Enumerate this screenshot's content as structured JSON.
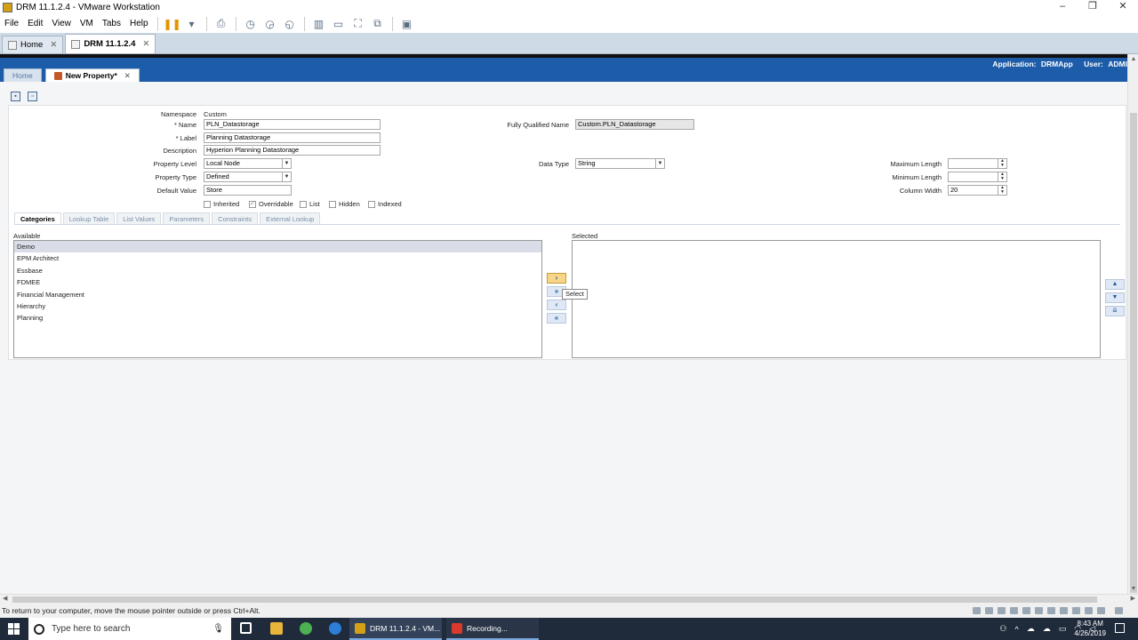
{
  "window": {
    "title": "DRM 11.1.2.4 - VMware Workstation",
    "controls": [
      "–",
      "❐",
      "✕"
    ]
  },
  "menubar": {
    "items": [
      "File",
      "Edit",
      "View",
      "VM",
      "Tabs",
      "Help"
    ]
  },
  "vm_tabs": [
    {
      "label": "Home",
      "active": false
    },
    {
      "label": "DRM 11.1.2.4",
      "active": true
    }
  ],
  "drm": {
    "banner": {
      "application_label": "Application:",
      "application_value": "DRMApp",
      "user_label": "User:",
      "user_value": "ADMI"
    },
    "tabs": [
      {
        "label": "Home",
        "active": false
      },
      {
        "label": "New Property*",
        "active": true
      }
    ],
    "form": {
      "namespace_label": "Namespace",
      "namespace_value": "Custom",
      "name_label": "* Name",
      "name_value": "PLN_Datastorage",
      "label_label": "* Label",
      "label_value": "Planning Datastorage",
      "description_label": "Description",
      "description_value": "Hyperion Planning Datastorage",
      "property_level_label": "Property Level",
      "property_level_value": "Local Node",
      "property_type_label": "Property Type",
      "property_type_value": "Defined",
      "default_value_label": "Default Value",
      "default_value_value": "Store",
      "fqn_label": "Fully Qualified Name",
      "fqn_value": "Custom.PLN_Datastorage",
      "data_type_label": "Data Type",
      "data_type_value": "String",
      "max_length_label": "Maximum Length",
      "max_length_value": "",
      "min_length_label": "Minimum Length",
      "min_length_value": "",
      "column_width_label": "Column Width",
      "column_width_value": "20",
      "checkboxes": [
        {
          "label": "Inherited",
          "checked": false
        },
        {
          "label": "Overridable",
          "checked": true
        },
        {
          "label": "List",
          "checked": false
        },
        {
          "label": "Hidden",
          "checked": false
        },
        {
          "label": "Indexed",
          "checked": false
        }
      ]
    },
    "subtabs": [
      {
        "label": "Categories",
        "active": true
      },
      {
        "label": "Lookup Table",
        "active": false
      },
      {
        "label": "List Values",
        "active": false
      },
      {
        "label": "Parameters",
        "active": false
      },
      {
        "label": "Constraints",
        "active": false
      },
      {
        "label": "External Lookup",
        "active": false
      }
    ],
    "available_label": "Available",
    "selected_label": "Selected",
    "available_items": [
      "Demo",
      "EPM Architect",
      "Essbase",
      "FDMEE",
      "Financial Management",
      "Hierarchy",
      "Planning"
    ],
    "selected_items": [],
    "tooltip": "Select"
  },
  "statusbar": {
    "message": "To return to your computer, move the mouse pointer outside or press Ctrl+Alt."
  },
  "taskbar": {
    "search_placeholder": "Type here to search",
    "running": [
      {
        "label": "DRM 11.1.2.4 - VM...",
        "color": "#d4a017"
      },
      {
        "label": "Recording...",
        "color": "#d93a2b"
      }
    ],
    "time": "8:43 AM",
    "date": "4/26/2019"
  },
  "colors": {
    "banner": "#1c5ca8",
    "accent": "#1c5ca8",
    "taskbar": "#1f2a3a"
  }
}
